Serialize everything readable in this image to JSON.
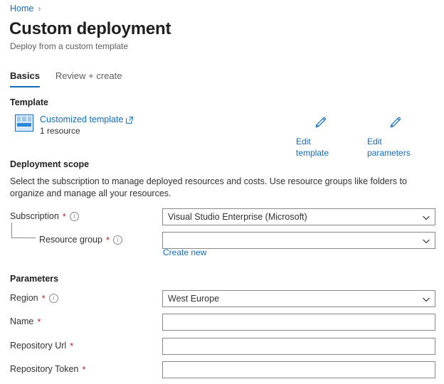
{
  "breadcrumb": {
    "home_label": "Home",
    "separator": "›"
  },
  "header": {
    "title": "Custom deployment",
    "subtitle": "Deploy from a custom template"
  },
  "tabs": [
    {
      "label": "Basics"
    },
    {
      "label": "Review + create"
    }
  ],
  "template_section": {
    "heading": "Template",
    "link_label": "Customized template",
    "resource_count": "1 resource",
    "icon": "template-grid-icon",
    "external_link_icon": "external-link-icon"
  },
  "commands": [
    {
      "label": "Edit template",
      "icon": "pencil-icon"
    },
    {
      "label": "Edit parameters",
      "icon": "pencil-icon"
    }
  ],
  "deployment_scope": {
    "heading": "Deployment scope",
    "description": "Select the subscription to manage deployed resources and costs. Use resource groups like folders to organize and manage all your resources.",
    "subscription": {
      "label": "Subscription",
      "required_marker": "*",
      "value": "Visual Studio Enterprise (Microsoft)"
    },
    "resource_group": {
      "label": "Resource group",
      "required_marker": "*",
      "value": "",
      "create_new_label": "Create new"
    }
  },
  "parameters": {
    "heading": "Parameters",
    "fields": [
      {
        "label": "Region",
        "required_marker": "*",
        "value": "West Europe",
        "type": "dropdown",
        "has_info": true
      },
      {
        "label": "Name",
        "required_marker": "*",
        "value": "",
        "type": "text",
        "has_info": false
      },
      {
        "label": "Repository Url",
        "required_marker": "*",
        "value": "",
        "type": "text",
        "has_info": false
      },
      {
        "label": "Repository Token",
        "required_marker": "*",
        "value": "",
        "type": "text",
        "has_info": false
      }
    ]
  },
  "colors": {
    "accent": "#0f6cbd",
    "required": "#a4262c",
    "border": "#8a8886",
    "text": "#323130"
  }
}
